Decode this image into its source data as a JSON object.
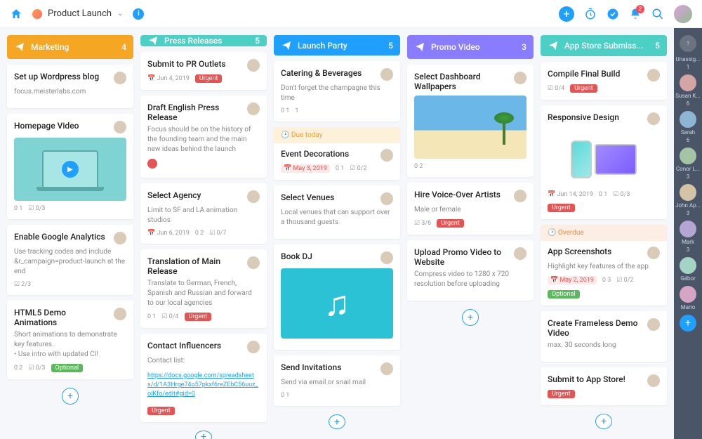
{
  "header": {
    "project": "Product Launch"
  },
  "columns": [
    {
      "title": "Marketing",
      "count": 4,
      "color": "#f5a623",
      "icon": "megaphone"
    },
    {
      "title": "Press Releases",
      "count": 5,
      "color": "#4ccfc5",
      "icon": "megaphone"
    },
    {
      "title": "Launch Party",
      "count": 5,
      "color": "#1fa0ff",
      "icon": "megaphone"
    },
    {
      "title": "Promo Video",
      "count": 3,
      "color": "#8a7cff",
      "icon": "video"
    },
    {
      "title": "App Store Submiss...",
      "count": 5,
      "color": "#4ccfc5",
      "icon": "gear"
    }
  ],
  "cards": {
    "c0": [
      {
        "t": "Set up Wordpress blog",
        "d": "focus.meisterlabs.com"
      },
      {
        "t": "Homepage Video",
        "img": "laptop",
        "m": [
          "0 1",
          "0/3"
        ]
      },
      {
        "t": "Enable Google Analytics",
        "d": "Use tracking codes and include &r_campaign=product-launch at the end",
        "m": [
          "2/3"
        ]
      },
      {
        "t": "HTML5 Demo Animations",
        "d": "Short animations to demonstrate key features.\n• Use intro with updated CI!",
        "m": [
          "0 2",
          "0/3"
        ],
        "tag": "Optional"
      }
    ],
    "c1": [
      {
        "t": "Submit to PR Outlets",
        "m": [
          "Jun 4, 2019"
        ],
        "tag": "Urgent"
      },
      {
        "t": "Draft English Press Release",
        "d": "Focus should be on the history of the founding team and the main new ideas behind the launch",
        "minus": true
      },
      {
        "t": "Select Agency",
        "d": "Limit to SF and LA animation studios",
        "m": [
          "Jun 6, 2019",
          "0 2",
          "0/7"
        ]
      },
      {
        "t": "Translation of Main Release",
        "d": "Translate to German, French, Spanish and Russian and forward to our local agencies",
        "m": [
          "0 1",
          "0/4"
        ],
        "tag": "Urgent"
      },
      {
        "t": "Contact Influencers",
        "d": "Contact list:",
        "link": "https://docs.google.com/spreadsheets/d/1A3Hrge74o57pkxf6reZEbC56uuz_oiKfo/edit#gid=0",
        "tag": "Urgent"
      }
    ],
    "c2": [
      {
        "t": "Catering & Beverages",
        "d": "Don't forget the champagne this time",
        "m": [
          "0 1",
          "1"
        ]
      },
      {
        "due": "Due today",
        "t": "Event Decorations",
        "m": [
          "May 3, 2019",
          "0 1",
          "0/2"
        ],
        "dateRed": true
      },
      {
        "t": "Select Venues",
        "d": "Local venues that can support over a thousand guests"
      },
      {
        "t": "Book DJ",
        "img": "music"
      },
      {
        "t": "Send Invitations",
        "d": "Send via email or snail mail",
        "m": [
          "0 1"
        ]
      }
    ],
    "c3": [
      {
        "t": "Select Dashboard Wallpapers",
        "img": "beach",
        "m": [
          "0 2"
        ]
      },
      {
        "t": "Hire Voice-Over Artists",
        "d": "Male or female",
        "m": [
          "3/6"
        ],
        "tag": "Urgent"
      },
      {
        "t": "Upload Promo Video to Website",
        "d": "Compress video to 1280 x 720 resolution before uploading"
      }
    ],
    "c4": [
      {
        "t": "Compile Final Build",
        "m": [
          "0/4"
        ],
        "tag": "Urgent"
      },
      {
        "t": "Responsive Design",
        "img": "devices",
        "m": [
          "Jun 14, 2019",
          "0 1",
          "0/3"
        ],
        "tag": "Urgent"
      },
      {
        "due": "Overdue",
        "ov": true,
        "t": "App Screenshots",
        "d": "Highlight key features of the app",
        "m": [
          "May 2, 2019",
          "0 3",
          "0/2"
        ],
        "tag": "Optional",
        "dateRed": true
      },
      {
        "t": "Create Frameless Demo Video",
        "d": "max. 30 seconds long"
      },
      {
        "t": "Submit to App Store!",
        "tag": "Urgent"
      }
    ]
  },
  "side": [
    {
      "n": "Unassig...",
      "c": "1"
    },
    {
      "n": "Susan K...",
      "c": "6"
    },
    {
      "n": "Sarah",
      "c": "6"
    },
    {
      "n": "Conor L...",
      "c": "3"
    },
    {
      "n": "John Ap...",
      "c": "3"
    },
    {
      "n": "Mark",
      "c": "3"
    },
    {
      "n": "Gábor",
      "c": ""
    },
    {
      "n": "Mario",
      "c": ""
    }
  ]
}
